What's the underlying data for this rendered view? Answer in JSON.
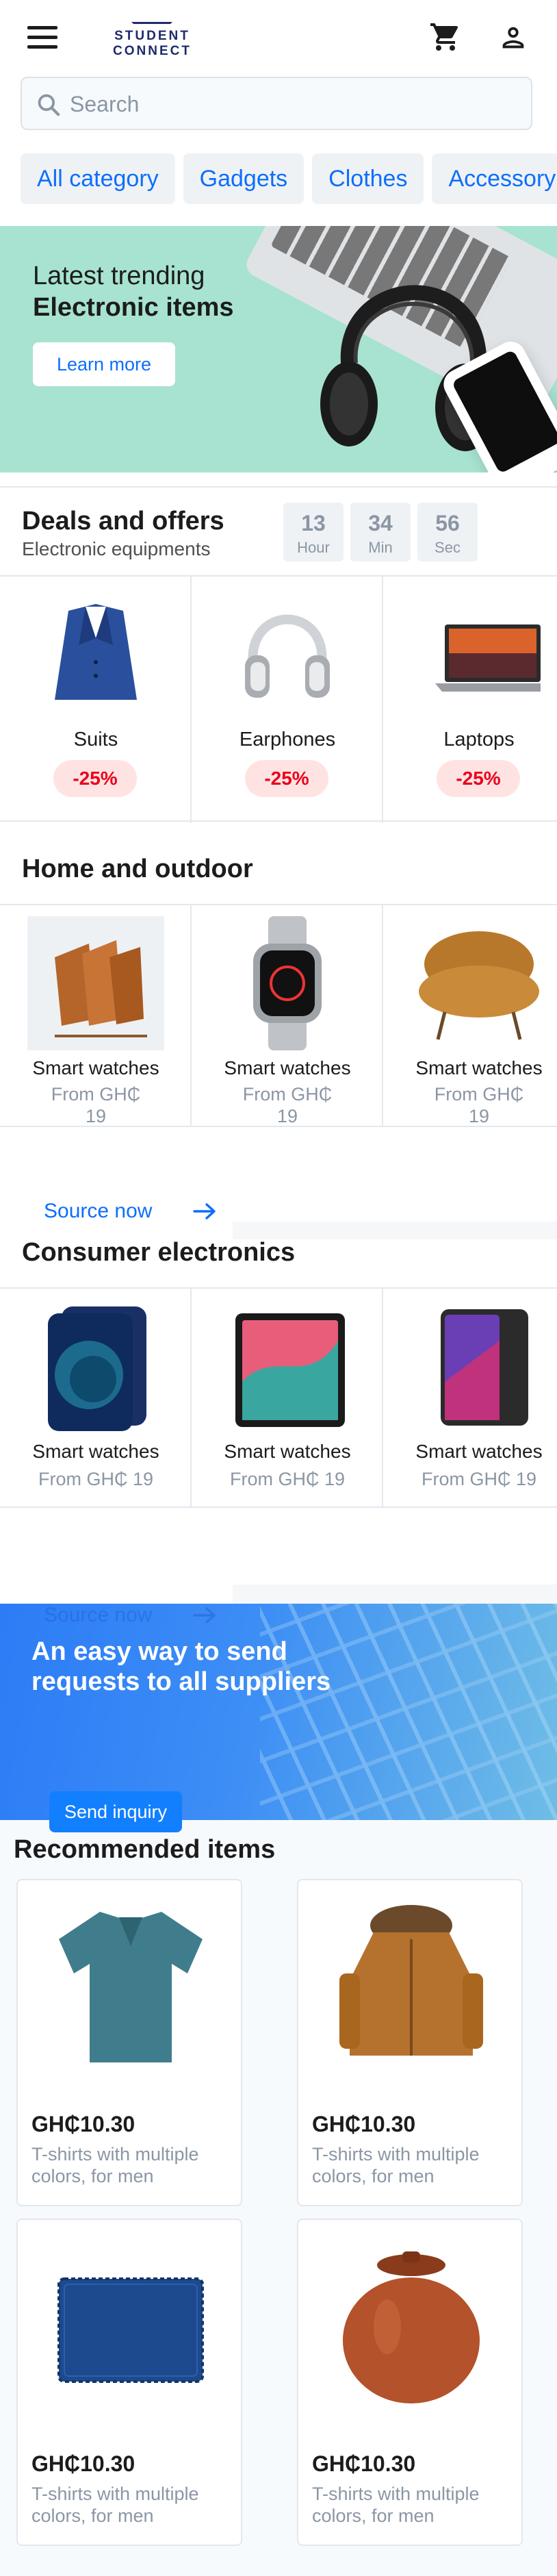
{
  "header": {
    "logo_line1": "STUDENT",
    "logo_line2": "CONNECT",
    "menu_icon": "hamburger-menu-icon",
    "cart_icon": "shopping-cart-icon",
    "user_icon": "user-profile-icon"
  },
  "search": {
    "placeholder": "Search",
    "value": ""
  },
  "categories": [
    "All category",
    "Gadgets",
    "Clothes",
    "Accessory"
  ],
  "hero": {
    "line1": "Latest trending",
    "line2": "Electronic items",
    "button_label": "Learn more",
    "background_color": "#a7e3d0"
  },
  "deals": {
    "title": "Deals and offers",
    "subtitle": "Electronic equipments",
    "timer": [
      {
        "value": "13",
        "unit": "Hour"
      },
      {
        "value": "34",
        "unit": "Min"
      },
      {
        "value": "56",
        "unit": "Sec"
      }
    ],
    "items": [
      {
        "name": "Suits",
        "discount": "-25%"
      },
      {
        "name": "Earphones",
        "discount": "-25%"
      },
      {
        "name": "Laptops",
        "discount": "-25%"
      }
    ]
  },
  "home_outdoor": {
    "title": "Home and outdoor",
    "items": [
      {
        "name": "Smart watches",
        "price_line1": "From GH₵",
        "price_line2": "19"
      },
      {
        "name": "Smart watches",
        "price_line1": "From GH₵",
        "price_line2": "19"
      },
      {
        "name": "Smart watches",
        "price_line1": "From GH₵",
        "price_line2": "19"
      }
    ],
    "source_link": "Source now"
  },
  "electronics": {
    "title": "Consumer electronics",
    "items": [
      {
        "name": "Smart watches",
        "price": "From GH₵ 19"
      },
      {
        "name": "Smart watches",
        "price": "From GH₵ 19"
      },
      {
        "name": "Smart watches",
        "price": "From GH₵ 19"
      }
    ],
    "source_link": "Source now"
  },
  "inquiry": {
    "title": "An easy way to send requests to all suppliers",
    "button_label": "Send inquiry"
  },
  "recommended": {
    "title": "Recommended items",
    "items": [
      {
        "price": "GH₵10.30",
        "description": "T-shirts with multiple colors, for men"
      },
      {
        "price": "GH₵10.30",
        "description": "T-shirts with multiple colors, for men"
      },
      {
        "price": "GH₵10.30",
        "description": "T-shirts with multiple colors, for men"
      },
      {
        "price": "GH₵10.30",
        "description": "T-shirts with multiple colors, for men"
      }
    ]
  },
  "colors": {
    "accent": "#0d6efd",
    "discount_text": "#eb001b",
    "discount_bg": "#ffe3e3",
    "muted_text": "#8b96a5"
  }
}
